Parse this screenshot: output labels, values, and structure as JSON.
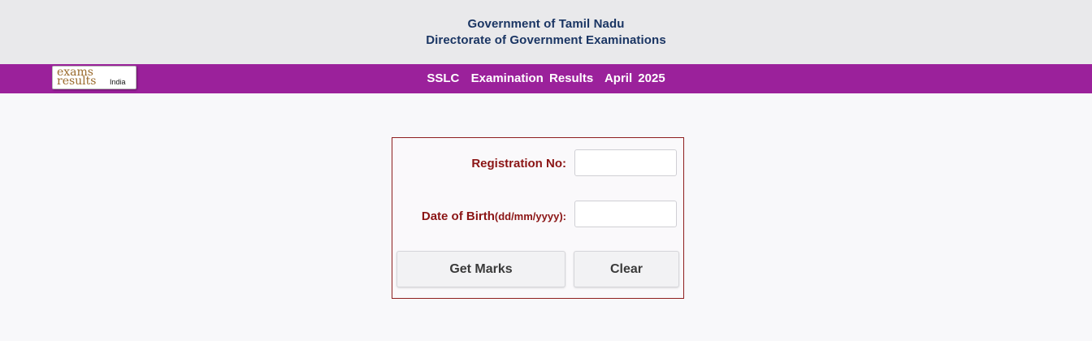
{
  "header": {
    "line1": "Government of Tamil Nadu",
    "line2": "Directorate of Government Examinations"
  },
  "banner": {
    "title": "SSLC  Examination Results  April 2025",
    "background_color": "#9b219b"
  },
  "logo": {
    "word1": "exams",
    "word2": "results",
    "word3": "India"
  },
  "form": {
    "registration_label": "Registration No:",
    "registration_value": "",
    "dob_label": "Date of Birth",
    "dob_format": "(dd/mm/yyyy):",
    "dob_value": "",
    "get_marks_label": "Get Marks",
    "clear_label": "Clear",
    "label_color": "#8b1515",
    "border_color": "#8e1f1f"
  }
}
